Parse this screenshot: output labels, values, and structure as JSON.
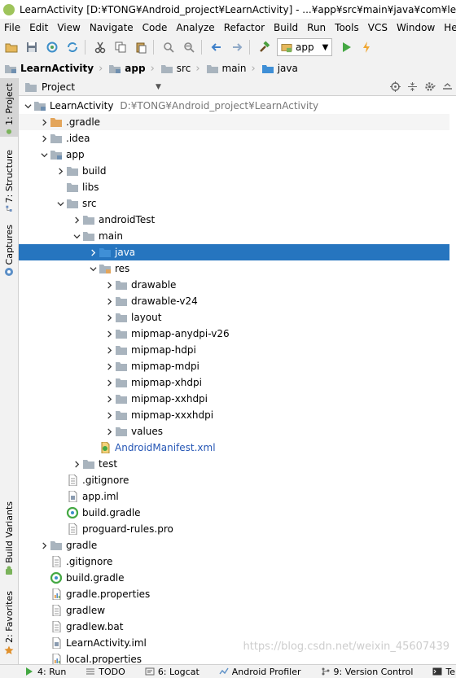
{
  "window": {
    "title": "LearnActivity [D:¥TONG¥Android_project¥LearnActivity] - ...¥app¥src¥main¥java¥com¥learnactivity¥"
  },
  "menu": [
    "File",
    "Edit",
    "View",
    "Navigate",
    "Code",
    "Analyze",
    "Refactor",
    "Build",
    "Run",
    "Tools",
    "VCS",
    "Window",
    "Help"
  ],
  "toolbar": {
    "run_config": "app"
  },
  "breadcrumbs": [
    "LearnActivity",
    "app",
    "src",
    "main",
    "java"
  ],
  "side_tabs": {
    "project": "1: Project",
    "structure": "7: Structure",
    "captures": "Captures",
    "build_variants": "Build Variants",
    "favorites": "2: Favorites"
  },
  "panel": {
    "title": "Project"
  },
  "tree": [
    {
      "label": "LearnActivity",
      "path": "D:¥TONG¥Android_project¥LearnActivity",
      "depth": 0,
      "arrow": "down",
      "icon": "module-folder-icon"
    },
    {
      "label": ".gradle",
      "depth": 1,
      "arrow": "right",
      "icon": "orange-folder-icon",
      "hover": true
    },
    {
      "label": ".idea",
      "depth": 1,
      "arrow": "right",
      "icon": "folder-icon"
    },
    {
      "label": "app",
      "depth": 1,
      "arrow": "down",
      "icon": "module-folder-icon"
    },
    {
      "label": "build",
      "depth": 2,
      "arrow": "right",
      "icon": "folder-icon"
    },
    {
      "label": "libs",
      "depth": 2,
      "arrow": "none",
      "icon": "folder-icon"
    },
    {
      "label": "src",
      "depth": 2,
      "arrow": "down",
      "icon": "folder-icon"
    },
    {
      "label": "androidTest",
      "depth": 3,
      "arrow": "right",
      "icon": "folder-icon"
    },
    {
      "label": "main",
      "depth": 3,
      "arrow": "down",
      "icon": "folder-icon"
    },
    {
      "label": "java",
      "depth": 4,
      "arrow": "right",
      "icon": "source-folder-icon",
      "selected": true
    },
    {
      "label": "res",
      "depth": 4,
      "arrow": "down",
      "icon": "res-folder-icon"
    },
    {
      "label": "drawable",
      "depth": 5,
      "arrow": "right",
      "icon": "folder-icon"
    },
    {
      "label": "drawable-v24",
      "depth": 5,
      "arrow": "right",
      "icon": "folder-icon"
    },
    {
      "label": "layout",
      "depth": 5,
      "arrow": "right",
      "icon": "folder-icon"
    },
    {
      "label": "mipmap-anydpi-v26",
      "depth": 5,
      "arrow": "right",
      "icon": "folder-icon"
    },
    {
      "label": "mipmap-hdpi",
      "depth": 5,
      "arrow": "right",
      "icon": "folder-icon"
    },
    {
      "label": "mipmap-mdpi",
      "depth": 5,
      "arrow": "right",
      "icon": "folder-icon"
    },
    {
      "label": "mipmap-xhdpi",
      "depth": 5,
      "arrow": "right",
      "icon": "folder-icon"
    },
    {
      "label": "mipmap-xxhdpi",
      "depth": 5,
      "arrow": "right",
      "icon": "folder-icon"
    },
    {
      "label": "mipmap-xxxhdpi",
      "depth": 5,
      "arrow": "right",
      "icon": "folder-icon"
    },
    {
      "label": "values",
      "depth": 5,
      "arrow": "right",
      "icon": "folder-icon"
    },
    {
      "label": "AndroidManifest.xml",
      "depth": 4,
      "arrow": "none",
      "icon": "manifest-icon",
      "blue": true
    },
    {
      "label": "test",
      "depth": 3,
      "arrow": "right",
      "icon": "folder-icon"
    },
    {
      "label": ".gitignore",
      "depth": 2,
      "arrow": "none",
      "icon": "text-file-icon"
    },
    {
      "label": "app.iml",
      "depth": 2,
      "arrow": "none",
      "icon": "iml-file-icon"
    },
    {
      "label": "build.gradle",
      "depth": 2,
      "arrow": "none",
      "icon": "gradle-file-icon"
    },
    {
      "label": "proguard-rules.pro",
      "depth": 2,
      "arrow": "none",
      "icon": "text-file-icon"
    },
    {
      "label": "gradle",
      "depth": 1,
      "arrow": "right",
      "icon": "folder-icon"
    },
    {
      "label": ".gitignore",
      "depth": 1,
      "arrow": "none",
      "icon": "text-file-icon"
    },
    {
      "label": "build.gradle",
      "depth": 1,
      "arrow": "none",
      "icon": "gradle-file-icon"
    },
    {
      "label": "gradle.properties",
      "depth": 1,
      "arrow": "none",
      "icon": "properties-file-icon"
    },
    {
      "label": "gradlew",
      "depth": 1,
      "arrow": "none",
      "icon": "text-file-icon"
    },
    {
      "label": "gradlew.bat",
      "depth": 1,
      "arrow": "none",
      "icon": "text-file-icon"
    },
    {
      "label": "LearnActivity.iml",
      "depth": 1,
      "arrow": "none",
      "icon": "iml-file-icon"
    },
    {
      "label": "local.properties",
      "depth": 1,
      "arrow": "none",
      "icon": "properties-file-icon"
    }
  ],
  "bottom_tabs": [
    "4: Run",
    "TODO",
    "6: Logcat",
    "Android Profiler",
    "9: Version Control",
    "Terminal"
  ],
  "watermark": "https://blog.csdn.net/weixin_45607439",
  "colors": {
    "selection": "#2675bf",
    "folder": "#a9b4be",
    "source_folder": "#3f8fd6",
    "orange_folder": "#e3a55b",
    "run_green": "#44a843",
    "accent_blue": "#2556b5"
  }
}
